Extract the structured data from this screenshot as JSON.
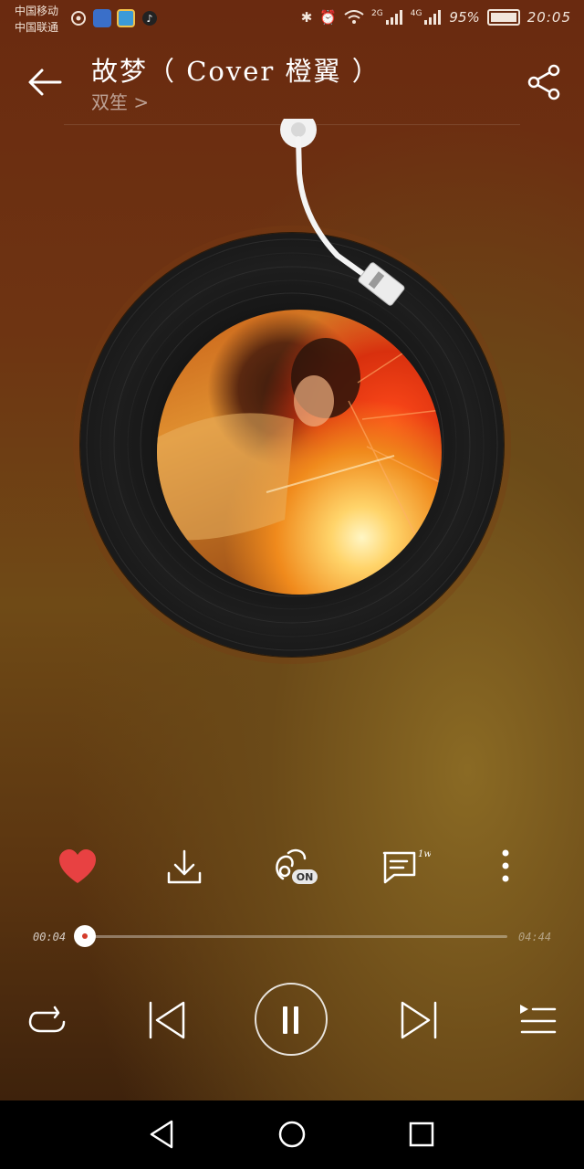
{
  "status_bar": {
    "carrier_1": "中国移动",
    "carrier_2": "中国联通",
    "network_1": "2G",
    "network_2": "4G",
    "battery": "95%",
    "time": "20:05"
  },
  "header": {
    "title": "故梦（ Cover 橙翼 ）",
    "artist": "双笙 >"
  },
  "actions": {
    "comments_badge": "1w+",
    "effect_badge": "ON"
  },
  "player": {
    "elapsed": "00:04",
    "duration": "04:44",
    "progress": 0.014
  },
  "colors": {
    "like": "#e84142",
    "accent_dot": "#d43b2b"
  },
  "icons": [
    "back-arrow-icon",
    "share-icon",
    "heart-icon",
    "download-icon",
    "sound-effect-icon",
    "comment-icon",
    "more-icon",
    "repeat-icon",
    "previous-icon",
    "pause-icon",
    "next-icon",
    "playlist-icon"
  ]
}
